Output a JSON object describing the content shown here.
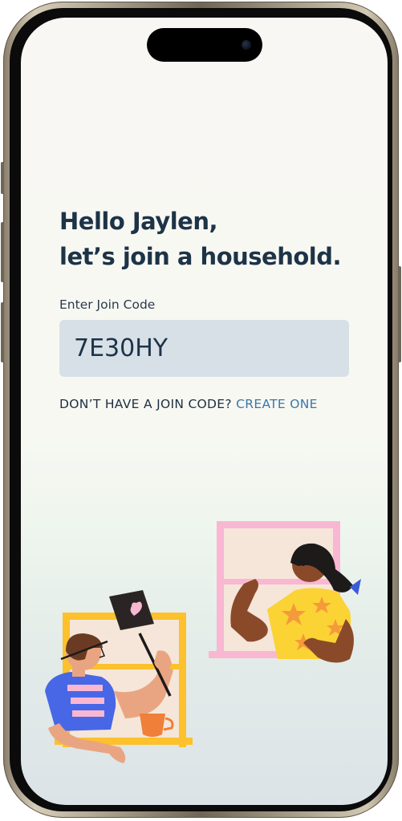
{
  "heading": {
    "line1": "Hello Jaylen,",
    "line2": "let’s join a household."
  },
  "join_code": {
    "label": "Enter Join Code",
    "value": "7E30HY"
  },
  "no_code": {
    "prompt": "DON’T HAVE A JOIN CODE?",
    "link": "CREATE ONE"
  },
  "colors": {
    "heading": "#1d3347",
    "link": "#3a78a8",
    "input_bg": "#d7e0e7"
  },
  "icons": [
    "neighbors-illustration",
    "heart-sign-icon"
  ]
}
